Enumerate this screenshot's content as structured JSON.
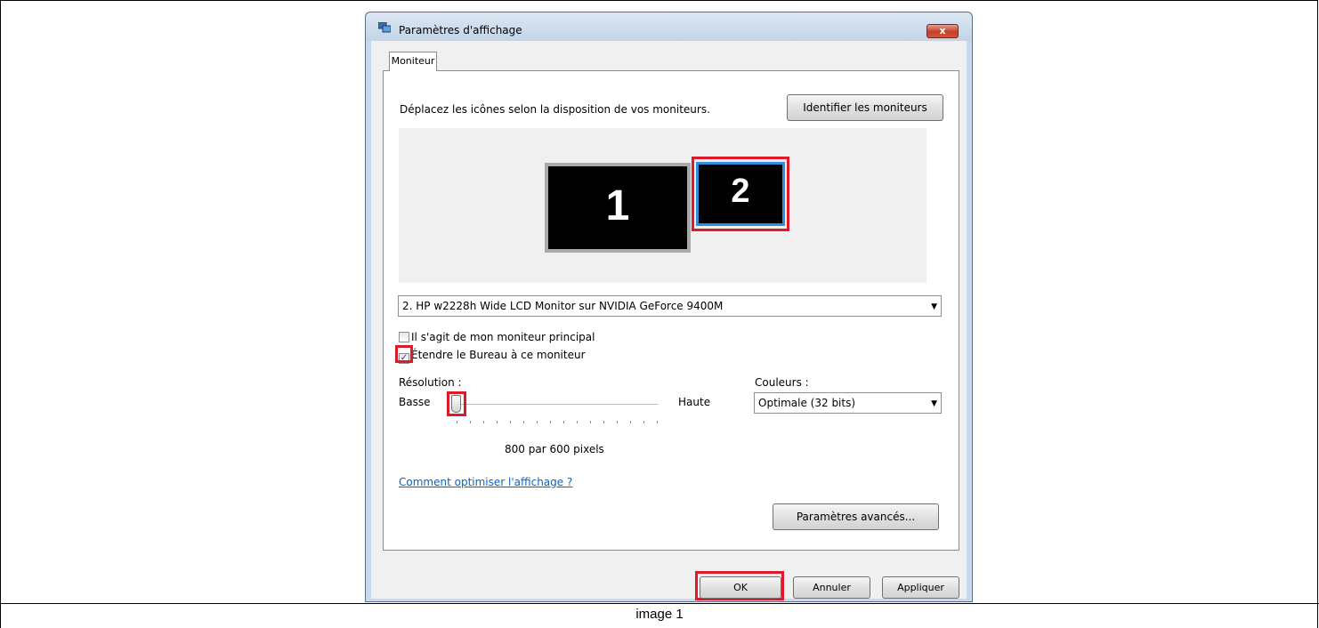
{
  "window": {
    "title": "Paramètres d'affichage",
    "close_glyph": "x"
  },
  "tabs": [
    {
      "label": "Moniteur"
    }
  ],
  "panel": {
    "instruction": "Déplacez les icônes selon la disposition de vos moniteurs.",
    "identify_button": "Identifier les moniteurs",
    "monitors": [
      {
        "label": "1"
      },
      {
        "label": "2"
      }
    ],
    "monitor_select": "2. HP w2228h Wide LCD Monitor sur NVIDIA GeForce 9400M",
    "checkboxes": [
      {
        "label": "Il s'agit de mon moniteur principal",
        "checked": false
      },
      {
        "label": "Étendre le Bureau à ce moniteur",
        "checked": true
      }
    ],
    "resolution": {
      "label": "Résolution :",
      "low": "Basse",
      "high": "Haute",
      "value_text": "800 par 600 pixels",
      "level": 0
    },
    "colors": {
      "label": "Couleurs :",
      "selected": "Optimale (32 bits)"
    },
    "help_link": "Comment optimiser l'affichage ?",
    "advanced_button": "Paramètres avancés..."
  },
  "footer": {
    "ok": "OK",
    "cancel": "Annuler",
    "apply": "Appliquer"
  },
  "caption": "image 1",
  "colors": {
    "highlight": "#e0182b",
    "link": "#0066cc",
    "selected_monitor_border": "#2f8fdc"
  }
}
